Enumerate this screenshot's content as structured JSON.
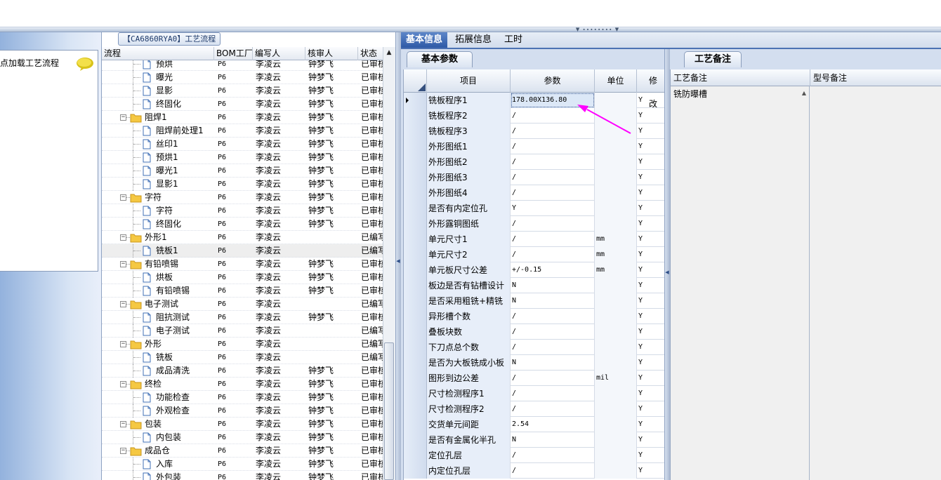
{
  "tree_panel": {
    "title": "【CA6860RYA0】工艺流程",
    "columns": [
      "流程",
      "BOM工厂",
      "编写人",
      "核审人",
      "状态"
    ],
    "rows": [
      {
        "name": "预烘",
        "bom": "P6",
        "author": "李凌云",
        "reviewer": "钟梦飞",
        "status": "已审核"
      },
      {
        "name": "曝光",
        "bom": "P6",
        "author": "李凌云",
        "reviewer": "钟梦飞",
        "status": "已审核"
      },
      {
        "name": "显影",
        "bom": "P6",
        "author": "李凌云",
        "reviewer": "钟梦飞",
        "status": "已审核"
      },
      {
        "name": "终固化",
        "bom": "P6",
        "author": "李凌云",
        "reviewer": "钟梦飞",
        "status": "已审核"
      },
      {
        "name": "阻焊1",
        "bom": "P6",
        "author": "李凌云",
        "reviewer": "钟梦飞",
        "status": "已审核"
      },
      {
        "name": "阻焊前处理1",
        "bom": "P6",
        "author": "李凌云",
        "reviewer": "钟梦飞",
        "status": "已审核"
      },
      {
        "name": "丝印1",
        "bom": "P6",
        "author": "李凌云",
        "reviewer": "钟梦飞",
        "status": "已审核"
      },
      {
        "name": "预烘1",
        "bom": "P6",
        "author": "李凌云",
        "reviewer": "钟梦飞",
        "status": "已审核"
      },
      {
        "name": "曝光1",
        "bom": "P6",
        "author": "李凌云",
        "reviewer": "钟梦飞",
        "status": "已审核"
      },
      {
        "name": "显影1",
        "bom": "P6",
        "author": "李凌云",
        "reviewer": "钟梦飞",
        "status": "已审核"
      },
      {
        "name": "字符",
        "bom": "P6",
        "author": "李凌云",
        "reviewer": "钟梦飞",
        "status": "已审核"
      },
      {
        "name": "字符",
        "bom": "P6",
        "author": "李凌云",
        "reviewer": "钟梦飞",
        "status": "已审核"
      },
      {
        "name": "终固化",
        "bom": "P6",
        "author": "李凌云",
        "reviewer": "钟梦飞",
        "status": "已审核"
      },
      {
        "name": "外形1",
        "bom": "P6",
        "author": "李凌云",
        "reviewer": "",
        "status": "已编写"
      },
      {
        "name": "铣板1",
        "bom": "P6",
        "author": "李凌云",
        "reviewer": "",
        "status": "已编写"
      },
      {
        "name": "有铅喷锡",
        "bom": "P6",
        "author": "李凌云",
        "reviewer": "钟梦飞",
        "status": "已审核"
      },
      {
        "name": "烘板",
        "bom": "P6",
        "author": "李凌云",
        "reviewer": "钟梦飞",
        "status": "已审核"
      },
      {
        "name": "有铅喷锡",
        "bom": "P6",
        "author": "李凌云",
        "reviewer": "钟梦飞",
        "status": "已审核"
      },
      {
        "name": "电子测试",
        "bom": "P6",
        "author": "李凌云",
        "reviewer": "",
        "status": "已编写"
      },
      {
        "name": "阻抗测试",
        "bom": "P6",
        "author": "李凌云",
        "reviewer": "钟梦飞",
        "status": "已审核"
      },
      {
        "name": "电子测试",
        "bom": "P6",
        "author": "李凌云",
        "reviewer": "",
        "status": "已编写"
      },
      {
        "name": "外形",
        "bom": "P6",
        "author": "李凌云",
        "reviewer": "",
        "status": "已编写"
      },
      {
        "name": "铣板",
        "bom": "P6",
        "author": "李凌云",
        "reviewer": "",
        "status": "已编写"
      },
      {
        "name": "成品清洗",
        "bom": "P6",
        "author": "李凌云",
        "reviewer": "钟梦飞",
        "status": "已审核"
      },
      {
        "name": "终检",
        "bom": "P6",
        "author": "李凌云",
        "reviewer": "钟梦飞",
        "status": "已审核"
      },
      {
        "name": "功能检查",
        "bom": "P6",
        "author": "李凌云",
        "reviewer": "钟梦飞",
        "status": "已审核"
      },
      {
        "name": "外观检查",
        "bom": "P6",
        "author": "李凌云",
        "reviewer": "钟梦飞",
        "status": "已审核"
      },
      {
        "name": "包装",
        "bom": "P6",
        "author": "李凌云",
        "reviewer": "钟梦飞",
        "status": "已审核"
      },
      {
        "name": "内包装",
        "bom": "P6",
        "author": "李凌云",
        "reviewer": "钟梦飞",
        "status": "已审核"
      },
      {
        "name": "成品仓",
        "bom": "P6",
        "author": "李凌云",
        "reviewer": "钟梦飞",
        "status": "已审核"
      },
      {
        "name": "入库",
        "bom": "P6",
        "author": "李凌云",
        "reviewer": "钟梦飞",
        "status": "已审核"
      },
      {
        "name": "外包装",
        "bom": "P6",
        "author": "李凌云",
        "reviewer": "钟梦飞",
        "status": "已审核"
      }
    ]
  },
  "left_panel": {
    "load_text": "点加载工艺流程",
    "icon": "speech-bubble-icon"
  },
  "tabs": [
    "基本信息",
    "拓展信息",
    "工时"
  ],
  "basic_params": {
    "tab_label": "基本参数",
    "columns": [
      "项目",
      "参数",
      "单位",
      "修改"
    ],
    "rows": [
      {
        "item": "铣板程序1",
        "param": "178.00X136.80",
        "unit": "",
        "mod": "Y"
      },
      {
        "item": "铣板程序2",
        "param": "/",
        "unit": "",
        "mod": "Y"
      },
      {
        "item": "铣板程序3",
        "param": "/",
        "unit": "",
        "mod": "Y"
      },
      {
        "item": "外形图纸1",
        "param": "/",
        "unit": "",
        "mod": "Y"
      },
      {
        "item": "外形图纸2",
        "param": "/",
        "unit": "",
        "mod": "Y"
      },
      {
        "item": "外形图纸3",
        "param": "/",
        "unit": "",
        "mod": "Y"
      },
      {
        "item": "外形图纸4",
        "param": "/",
        "unit": "",
        "mod": "Y"
      },
      {
        "item": "是否有内定位孔",
        "param": "Y",
        "unit": "",
        "mod": "Y"
      },
      {
        "item": "外形露铜图纸",
        "param": "/",
        "unit": "",
        "mod": "Y"
      },
      {
        "item": "单元尺寸1",
        "param": "/",
        "unit": "mm",
        "mod": "Y"
      },
      {
        "item": "单元尺寸2",
        "param": "/",
        "unit": "mm",
        "mod": "Y"
      },
      {
        "item": "单元板尺寸公差",
        "param": "+/-0.15",
        "unit": "mm",
        "mod": "Y"
      },
      {
        "item": "板边是否有钻槽设计",
        "param": "N",
        "unit": "",
        "mod": "Y"
      },
      {
        "item": "是否采用粗铣+精铣",
        "param": "N",
        "unit": "",
        "mod": "Y"
      },
      {
        "item": "异形槽个数",
        "param": "/",
        "unit": "",
        "mod": "Y"
      },
      {
        "item": "叠板块数",
        "param": "/",
        "unit": "",
        "mod": "Y"
      },
      {
        "item": "下刀点总个数",
        "param": "/",
        "unit": "",
        "mod": "Y"
      },
      {
        "item": "是否为大板铣成小板",
        "param": "N",
        "unit": "",
        "mod": "Y"
      },
      {
        "item": "图形到边公差",
        "param": "/",
        "unit": "mil",
        "mod": "Y"
      },
      {
        "item": "尺寸检测程序1",
        "param": "/",
        "unit": "",
        "mod": "Y"
      },
      {
        "item": "尺寸检测程序2",
        "param": "/",
        "unit": "",
        "mod": "Y"
      },
      {
        "item": "交货单元间距",
        "param": "2.54",
        "unit": "",
        "mod": "Y"
      },
      {
        "item": "是否有金属化半孔",
        "param": "N",
        "unit": "",
        "mod": "Y"
      },
      {
        "item": "定位孔层",
        "param": "/",
        "unit": "",
        "mod": "Y"
      },
      {
        "item": "内定位孔层",
        "param": "/",
        "unit": "",
        "mod": "Y"
      }
    ]
  },
  "notes": {
    "tab_label": "工艺备注",
    "columns": [
      "工艺备注",
      "型号备注"
    ],
    "process_note": "铣防曝槽",
    "model_note": ""
  },
  "colors": {
    "accent": "#2f5aa6",
    "annotation_arrow": "#ff00ff",
    "folder": "#f5c842"
  }
}
